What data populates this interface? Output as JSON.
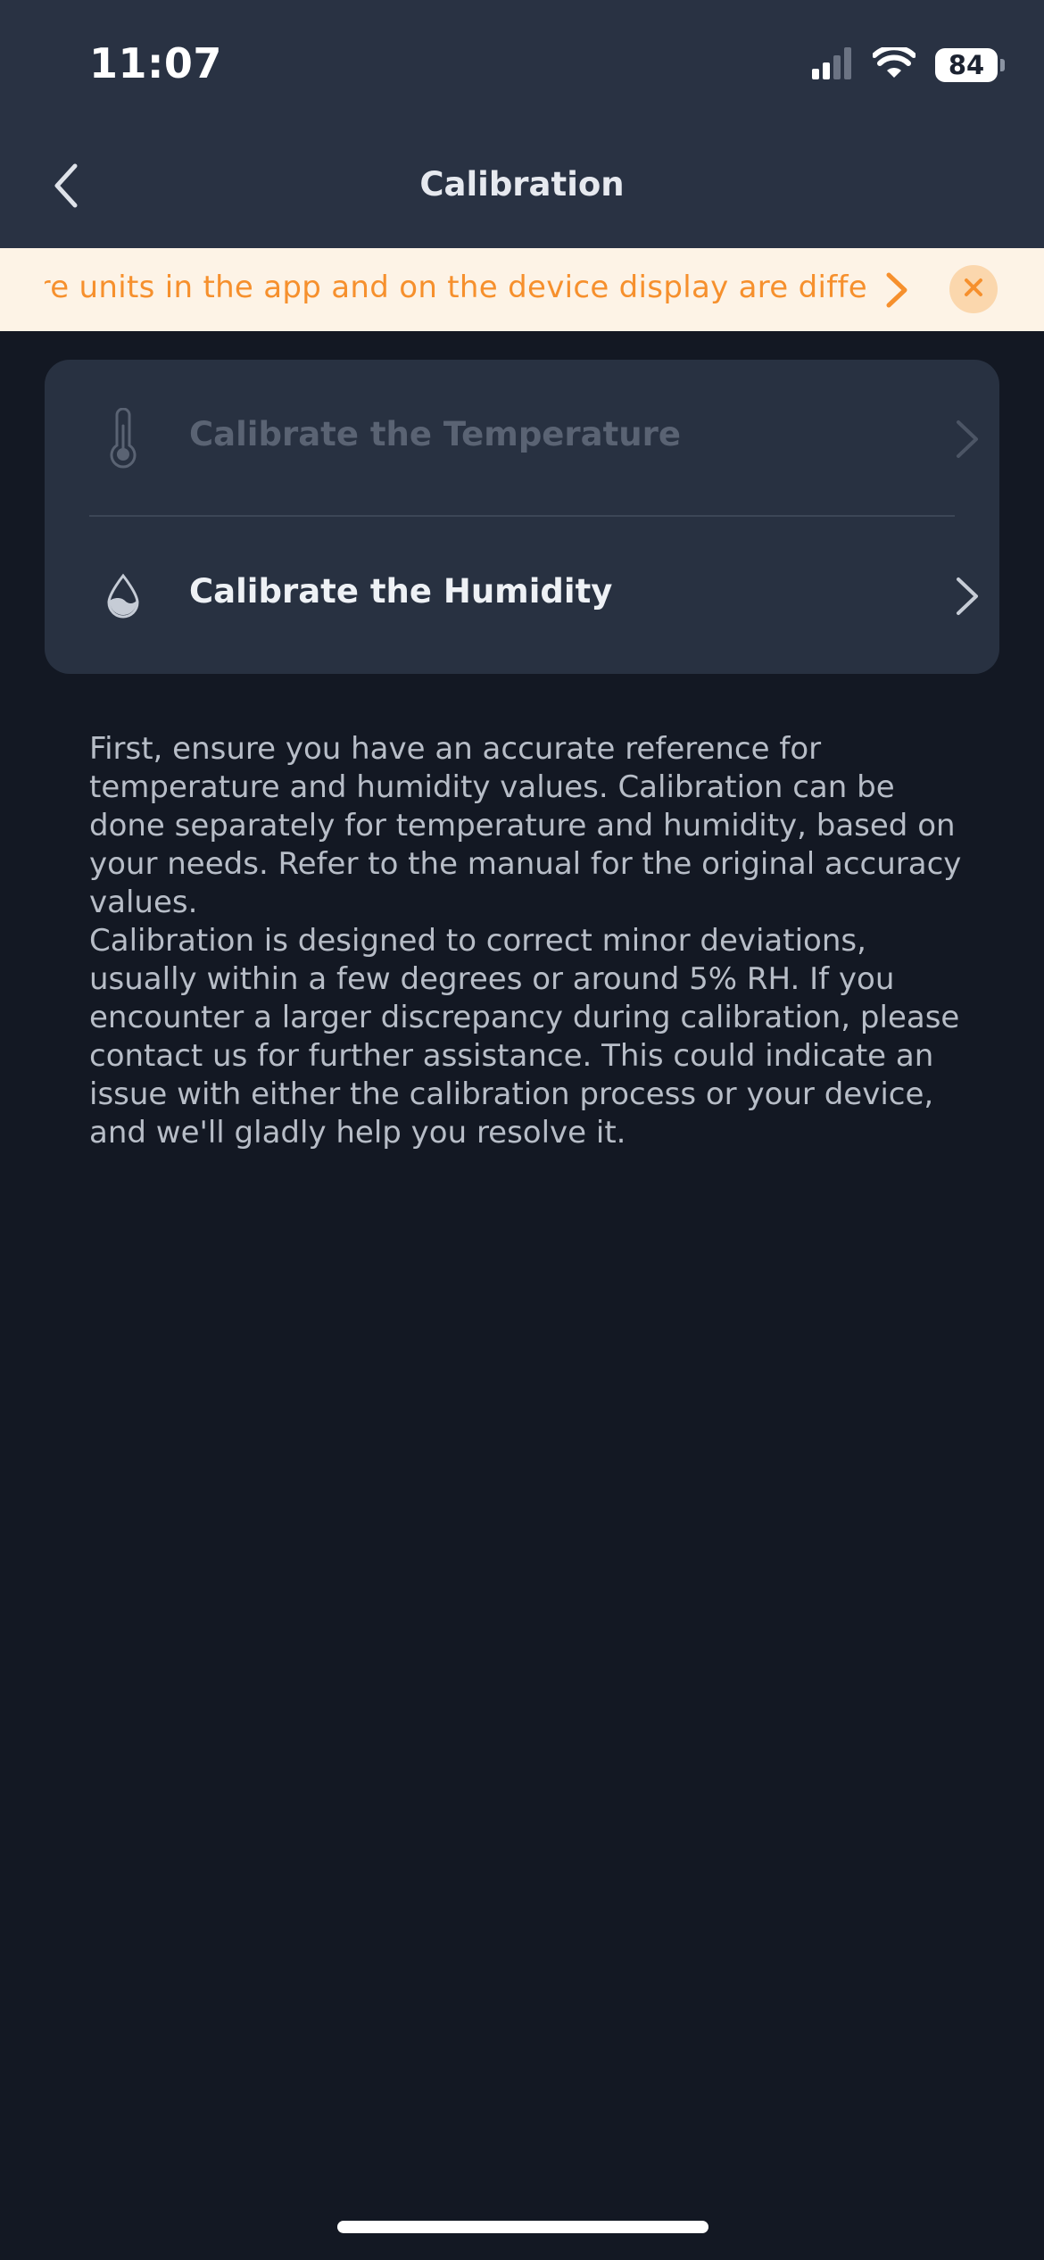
{
  "status_bar": {
    "time": "11:07",
    "battery_level": "84",
    "icons": [
      "cellular-signal-icon",
      "wifi-icon",
      "battery-icon"
    ]
  },
  "nav": {
    "title": "Calibration",
    "back_icon": "chevron-left-icon"
  },
  "notice": {
    "text": "ture units in the app and on the device display are diffe",
    "color": "#f6902d",
    "background": "#fdf3e6",
    "icons": [
      "chevron-right-icon",
      "close-icon"
    ]
  },
  "options": [
    {
      "label": "Calibrate the Temperature",
      "icon": "thermometer-icon",
      "enabled": false
    },
    {
      "label": "Calibrate the Humidity",
      "icon": "humidity-drop-icon",
      "enabled": true
    }
  ],
  "description": {
    "paragraph1": "First, ensure you have an accurate reference for temperature and humidity values. Calibration can be done separately for temperature and humidity, based on your needs. Refer to the manual for the original accuracy values.",
    "paragraph2": "Calibration is designed to correct minor deviations, usually within a few degrees or around 5% RH. If you encounter a larger discrepancy during calibration, please contact us for further assistance. This could indicate an issue with either the calibration process or your device, and we'll gladly help you resolve it."
  },
  "colors": {
    "header_bg": "#293243",
    "page_bg": "#131823",
    "card_bg": "#283141",
    "accent": "#f6902d"
  }
}
